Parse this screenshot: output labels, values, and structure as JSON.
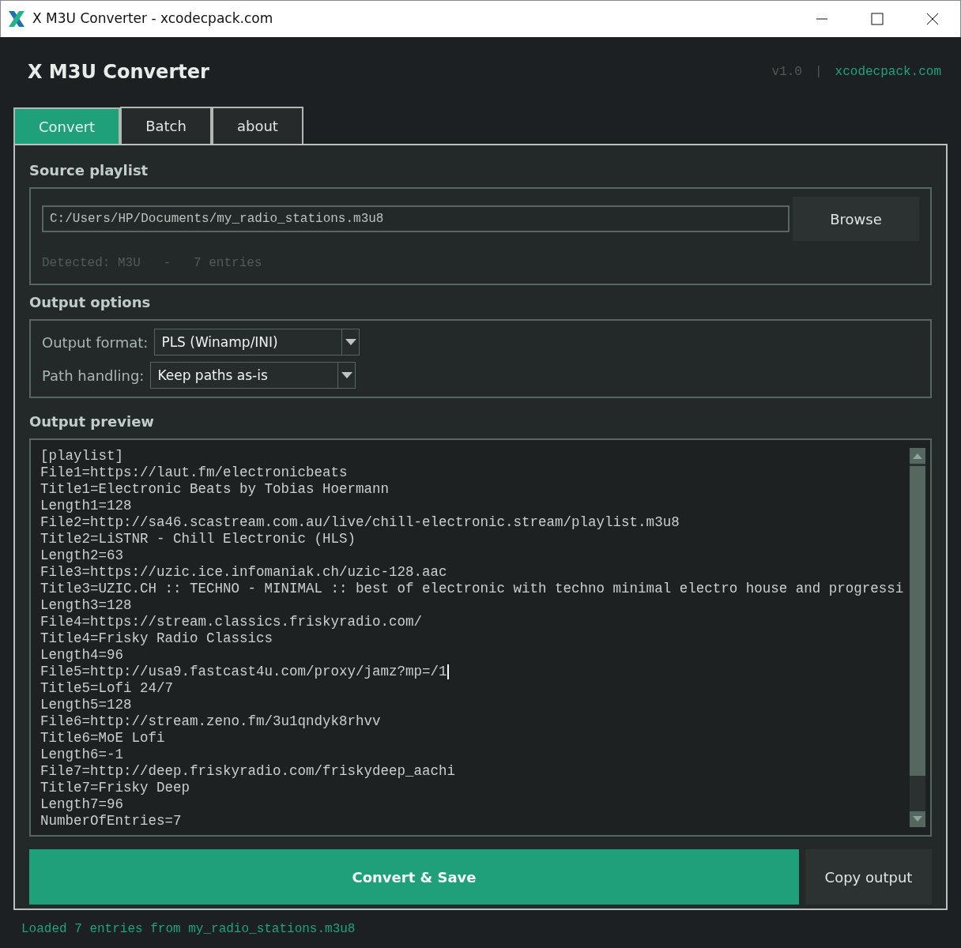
{
  "window": {
    "title": "X M3U Converter - xcodecpack.com"
  },
  "header": {
    "title": "X M3U Converter",
    "version": "v1.0",
    "separator": "|",
    "link": "xcodecpack.com"
  },
  "tabs": [
    {
      "label": "Convert",
      "selected": true
    },
    {
      "label": "Batch",
      "selected": false
    },
    {
      "label": "about",
      "selected": false
    }
  ],
  "source": {
    "heading": "Source playlist",
    "path": "C:/Users/HP/Documents/my_radio_stations.m3u8",
    "browse": "Browse",
    "detected": "Detected: M3U   -   7 entries"
  },
  "options": {
    "heading": "Output options",
    "fields": [
      {
        "label": "Output format:",
        "value": "PLS (Winamp/INI)"
      },
      {
        "label": "Path handling:",
        "value": "Keep paths as-is"
      }
    ]
  },
  "preview": {
    "heading": "Output preview",
    "lines": [
      {
        "text": "[playlist]",
        "cursor": false
      },
      {
        "text": "File1=https://laut.fm/electronicbeats",
        "cursor": false
      },
      {
        "text": "Title1=Electronic Beats by Tobias Hoermann",
        "cursor": false
      },
      {
        "text": "Length1=128",
        "cursor": false
      },
      {
        "text": "File2=http://sa46.scastream.com.au/live/chill-electronic.stream/playlist.m3u8",
        "cursor": false
      },
      {
        "text": "Title2=LiSTNR - Chill Electronic (HLS)",
        "cursor": false
      },
      {
        "text": "Length2=63",
        "cursor": false
      },
      {
        "text": "File3=https://uzic.ice.infomaniak.ch/uzic-128.aac",
        "cursor": false
      },
      {
        "text": "Title3=UZIC.CH :: TECHNO - MINIMAL :: best of electronic with techno minimal electro house and progressi",
        "cursor": false
      },
      {
        "text": "Length3=128",
        "cursor": false
      },
      {
        "text": "File4=https://stream.classics.friskyradio.com/",
        "cursor": false
      },
      {
        "text": "Title4=Frisky Radio Classics",
        "cursor": false
      },
      {
        "text": "Length4=96",
        "cursor": false
      },
      {
        "text": "File5=http://usa9.fastcast4u.com/proxy/jamz?mp=/1",
        "cursor": true
      },
      {
        "text": "Title5=Lofi 24/7",
        "cursor": false
      },
      {
        "text": "Length5=128",
        "cursor": false
      },
      {
        "text": "File6=http://stream.zeno.fm/3u1qndyk8rhvv",
        "cursor": false
      },
      {
        "text": "Title6=MoE Lofi",
        "cursor": false
      },
      {
        "text": "Length6=-1",
        "cursor": false
      },
      {
        "text": "File7=http://deep.friskyradio.com/friskydeep_aachi",
        "cursor": false
      },
      {
        "text": "Title7=Frisky Deep",
        "cursor": false
      },
      {
        "text": "Length7=96",
        "cursor": false
      },
      {
        "text": "NumberOfEntries=7",
        "cursor": false
      }
    ]
  },
  "actions": {
    "primary": "Convert & Save",
    "secondary": "Copy output"
  },
  "status_bar": "Loaded 7 entries from my_radio_stations.m3u8"
}
